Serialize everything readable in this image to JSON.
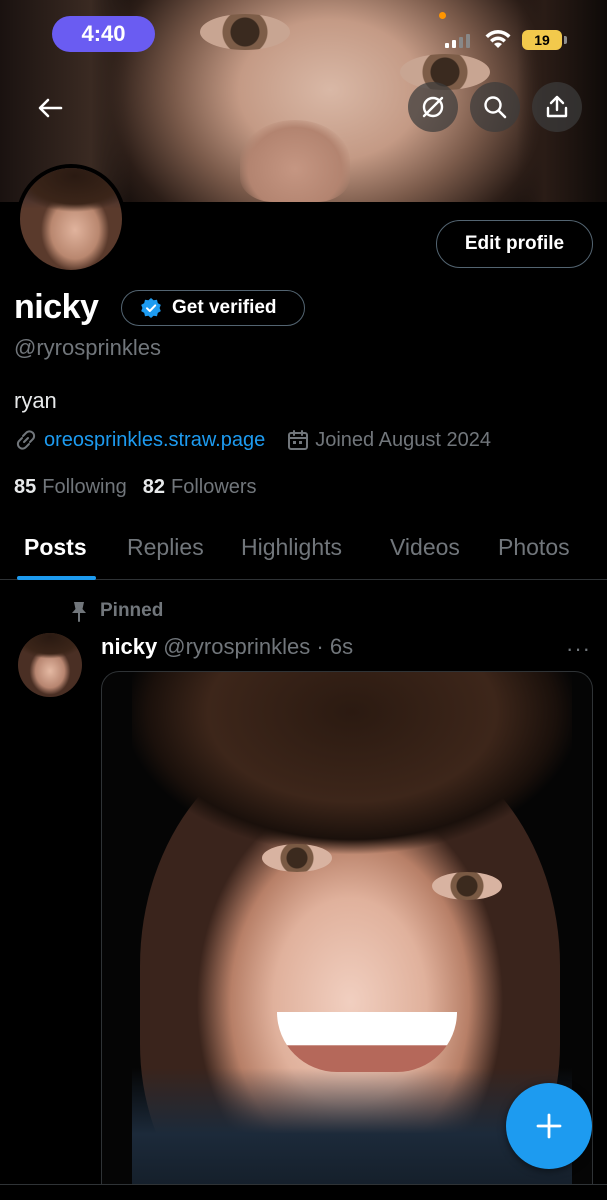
{
  "status_bar": {
    "time": "4:40",
    "battery": "19"
  },
  "profile": {
    "display_name": "nicky",
    "handle": "@ryrosprinkles",
    "bio": "ryan",
    "website": "oreosprinkles.straw.page",
    "joined": "Joined August 2024",
    "following_count": "85",
    "following_label": "Following",
    "followers_count": "82",
    "followers_label": "Followers",
    "edit_profile_label": "Edit profile",
    "get_verified_label": "Get verified"
  },
  "tabs": [
    {
      "label": "Posts",
      "active": true
    },
    {
      "label": "Replies",
      "active": false
    },
    {
      "label": "Highlights",
      "active": false
    },
    {
      "label": "Videos",
      "active": false
    },
    {
      "label": "Photos",
      "active": false
    }
  ],
  "post": {
    "pinned_label": "Pinned",
    "author_name": "nicky",
    "author_handle": "@ryrosprinkles",
    "time": "6s",
    "more_label": "···"
  },
  "colors": {
    "accent": "#1d9bf0",
    "time_pill": "#6a5cf2",
    "battery": "#f2c94c",
    "background": "#000000"
  },
  "icons": [
    "back-arrow-icon",
    "grok-icon",
    "search-icon",
    "share-icon",
    "verified-badge-icon",
    "link-icon",
    "calendar-icon",
    "pin-icon",
    "plus-icon"
  ]
}
